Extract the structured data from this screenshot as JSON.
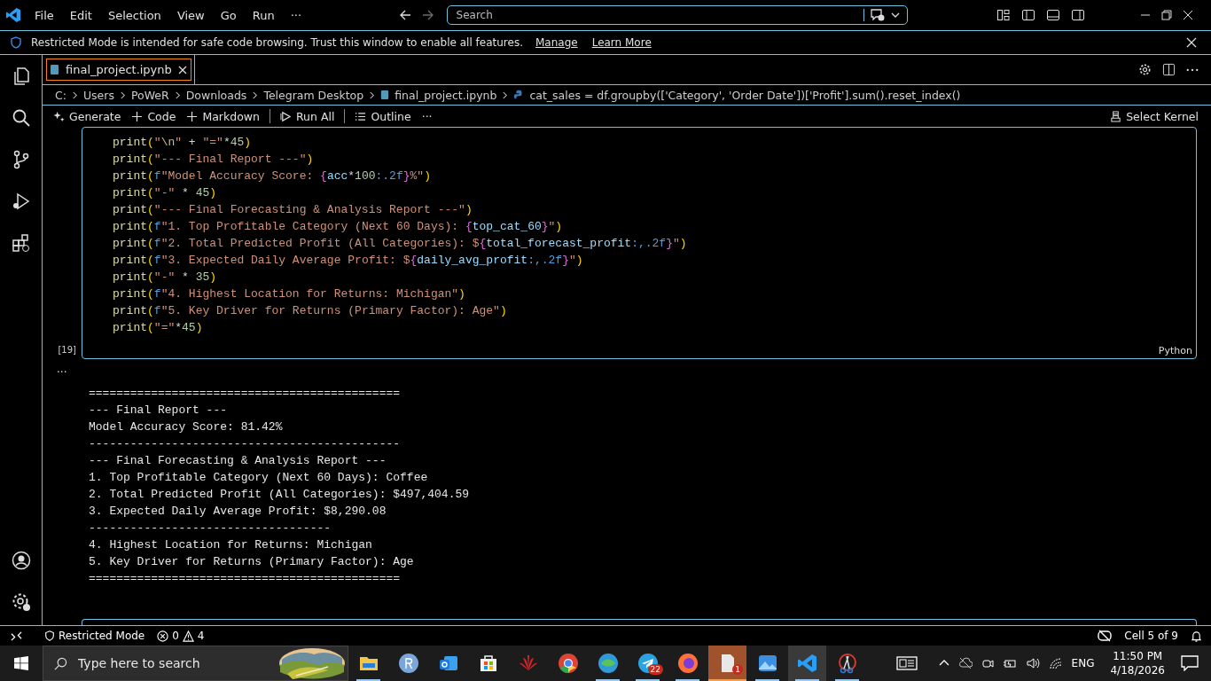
{
  "menu": [
    "File",
    "Edit",
    "Selection",
    "View",
    "Go",
    "Run",
    "···"
  ],
  "search": {
    "placeholder": "Search"
  },
  "banner": {
    "text": "Restricted Mode is intended for safe code browsing. Trust this window to enable all features.",
    "links": [
      "Manage",
      "Learn More"
    ]
  },
  "tabs": [
    {
      "label": "final_project.ipynb",
      "selected": true
    }
  ],
  "breadcrumb": [
    "C:",
    "Users",
    "PoWeR",
    "Downloads",
    "Telegram Desktop",
    "final_project.ipynb",
    "cat_sales = df.groupby(['Category', 'Order Date'])['Profit'].sum().reset_index()"
  ],
  "toolbar": [
    {
      "kind": "generate",
      "label": "Generate"
    },
    {
      "kind": "plus",
      "label": "Code"
    },
    {
      "kind": "plus",
      "label": "Markdown"
    },
    {
      "kind": "runall",
      "label": "Run All"
    },
    {
      "kind": "outline",
      "label": "Outline"
    },
    {
      "kind": "more",
      "label": "···"
    }
  ],
  "kernel": "Select Kernel",
  "cell": {
    "count": "[19]",
    "language": "Python",
    "lines": [
      [
        {
          "kind": "fn",
          "text": "print"
        },
        {
          "kind": "paren",
          "text": "("
        },
        {
          "kind": "str",
          "text": "\""
        },
        {
          "kind": "esc",
          "text": "\\n"
        },
        {
          "kind": "str",
          "text": "\""
        },
        {
          "kind": "op",
          "text": " + "
        },
        {
          "kind": "str",
          "text": "\"=\""
        },
        {
          "kind": "op",
          "text": "*"
        },
        {
          "kind": "num",
          "text": "45"
        },
        {
          "kind": "paren",
          "text": ")"
        }
      ],
      [
        {
          "kind": "fn",
          "text": "print"
        },
        {
          "kind": "paren",
          "text": "("
        },
        {
          "kind": "str",
          "text": "\"--- Final Report ---\""
        },
        {
          "kind": "paren",
          "text": ")"
        }
      ],
      [
        {
          "kind": "fn",
          "text": "print"
        },
        {
          "kind": "paren",
          "text": "("
        },
        {
          "kind": "kw",
          "text": "f"
        },
        {
          "kind": "str",
          "text": "\"Model Accuracy Score: "
        },
        {
          "kind": "brace",
          "text": "{"
        },
        {
          "kind": "var",
          "text": "acc"
        },
        {
          "kind": "op",
          "text": "*"
        },
        {
          "kind": "num",
          "text": "100"
        },
        {
          "kind": "kw",
          "text": ":.2f"
        },
        {
          "kind": "brace",
          "text": "}"
        },
        {
          "kind": "str",
          "text": "%\""
        },
        {
          "kind": "paren",
          "text": ")"
        }
      ],
      [
        {
          "kind": "fn",
          "text": "print"
        },
        {
          "kind": "paren",
          "text": "("
        },
        {
          "kind": "str",
          "text": "\"-\""
        },
        {
          "kind": "op",
          "text": " * "
        },
        {
          "kind": "num",
          "text": "45"
        },
        {
          "kind": "paren",
          "text": ")"
        }
      ],
      [
        {
          "kind": "fn",
          "text": "print"
        },
        {
          "kind": "paren",
          "text": "("
        },
        {
          "kind": "str",
          "text": "\"--- Final Forecasting & Analysis Report ---\""
        },
        {
          "kind": "paren",
          "text": ")"
        }
      ],
      [
        {
          "kind": "fn",
          "text": "print"
        },
        {
          "kind": "paren",
          "text": "("
        },
        {
          "kind": "kw",
          "text": "f"
        },
        {
          "kind": "str",
          "text": "\"1. Top Profitable Category (Next 60 Days): "
        },
        {
          "kind": "brace",
          "text": "{"
        },
        {
          "kind": "var",
          "text": "top_cat_60"
        },
        {
          "kind": "brace",
          "text": "}"
        },
        {
          "kind": "str",
          "text": "\""
        },
        {
          "kind": "paren",
          "text": ")"
        }
      ],
      [
        {
          "kind": "fn",
          "text": "print"
        },
        {
          "kind": "paren",
          "text": "("
        },
        {
          "kind": "kw",
          "text": "f"
        },
        {
          "kind": "str",
          "text": "\"2. Total Predicted Profit (All Categories): $"
        },
        {
          "kind": "brace",
          "text": "{"
        },
        {
          "kind": "var",
          "text": "total_forecast_profit"
        },
        {
          "kind": "kw",
          "text": ":,.2f"
        },
        {
          "kind": "brace",
          "text": "}"
        },
        {
          "kind": "str",
          "text": "\""
        },
        {
          "kind": "paren",
          "text": ")"
        }
      ],
      [
        {
          "kind": "fn",
          "text": "print"
        },
        {
          "kind": "paren",
          "text": "("
        },
        {
          "kind": "kw",
          "text": "f"
        },
        {
          "kind": "str",
          "text": "\"3. Expected Daily Average Profit: $"
        },
        {
          "kind": "brace",
          "text": "{"
        },
        {
          "kind": "var",
          "text": "daily_avg_profit"
        },
        {
          "kind": "kw",
          "text": ":,.2f"
        },
        {
          "kind": "brace",
          "text": "}"
        },
        {
          "kind": "str",
          "text": "\""
        },
        {
          "kind": "paren",
          "text": ")"
        }
      ],
      [
        {
          "kind": "fn",
          "text": "print"
        },
        {
          "kind": "paren",
          "text": "("
        },
        {
          "kind": "str",
          "text": "\"-\""
        },
        {
          "kind": "op",
          "text": " * "
        },
        {
          "kind": "num",
          "text": "35"
        },
        {
          "kind": "paren",
          "text": ")"
        }
      ],
      [
        {
          "kind": "fn",
          "text": "print"
        },
        {
          "kind": "paren",
          "text": "("
        },
        {
          "kind": "kw",
          "text": "f"
        },
        {
          "kind": "str",
          "text": "\"4. Highest Location for Returns: Michigan\""
        },
        {
          "kind": "paren",
          "text": ")"
        }
      ],
      [
        {
          "kind": "fn",
          "text": "print"
        },
        {
          "kind": "paren",
          "text": "("
        },
        {
          "kind": "kw",
          "text": "f"
        },
        {
          "kind": "str",
          "text": "\"5. Key Driver for Returns (Primary Factor): Age\""
        },
        {
          "kind": "paren",
          "text": ")"
        }
      ],
      [
        {
          "kind": "fn",
          "text": "print"
        },
        {
          "kind": "paren",
          "text": "("
        },
        {
          "kind": "str",
          "text": "\"=\""
        },
        {
          "kind": "op",
          "text": "*"
        },
        {
          "kind": "num",
          "text": "45"
        },
        {
          "kind": "paren",
          "text": ")"
        }
      ]
    ]
  },
  "output": {
    "marker": "···",
    "lines": [
      "=============================================",
      "--- Final Report ---",
      "Model Accuracy Score: 81.42%",
      "---------------------------------------------",
      "--- Final Forecasting & Analysis Report ---",
      "1. Top Profitable Category (Next 60 Days): Coffee",
      "2. Total Predicted Profit (All Categories): $497,404.59",
      "3. Expected Daily Average Profit: $8,290.08",
      "-----------------------------------",
      "4. Highest Location for Returns: Michigan",
      "5. Key Driver for Returns (Primary Factor): Age",
      "============================================="
    ]
  },
  "status_bar": {
    "mode": "Restricted Mode",
    "errors": "0",
    "warnings": "4",
    "cell": "Cell 5 of 9"
  },
  "taskbar": {
    "search_placeholder": "Type here to search",
    "apps": [
      {
        "kind": "folder",
        "running": true
      },
      {
        "kind": "r",
        "running": false
      },
      {
        "kind": "mail",
        "running": false
      },
      {
        "kind": "store",
        "running": false
      },
      {
        "kind": "flower",
        "running": false
      },
      {
        "kind": "chrome",
        "running": false
      },
      {
        "kind": "globe",
        "running": true
      },
      {
        "kind": "telegram",
        "running": true,
        "badge": "22"
      },
      {
        "kind": "firefox",
        "running": true
      },
      {
        "kind": "document",
        "running": true,
        "active": true,
        "badge": "1"
      },
      {
        "kind": "photos",
        "running": true
      },
      {
        "kind": "vscode",
        "running": true,
        "focused": true
      },
      {
        "kind": "scissors",
        "running": true
      }
    ],
    "language": "ENG",
    "time": "11:50 PM",
    "date": "4/18/2026"
  }
}
